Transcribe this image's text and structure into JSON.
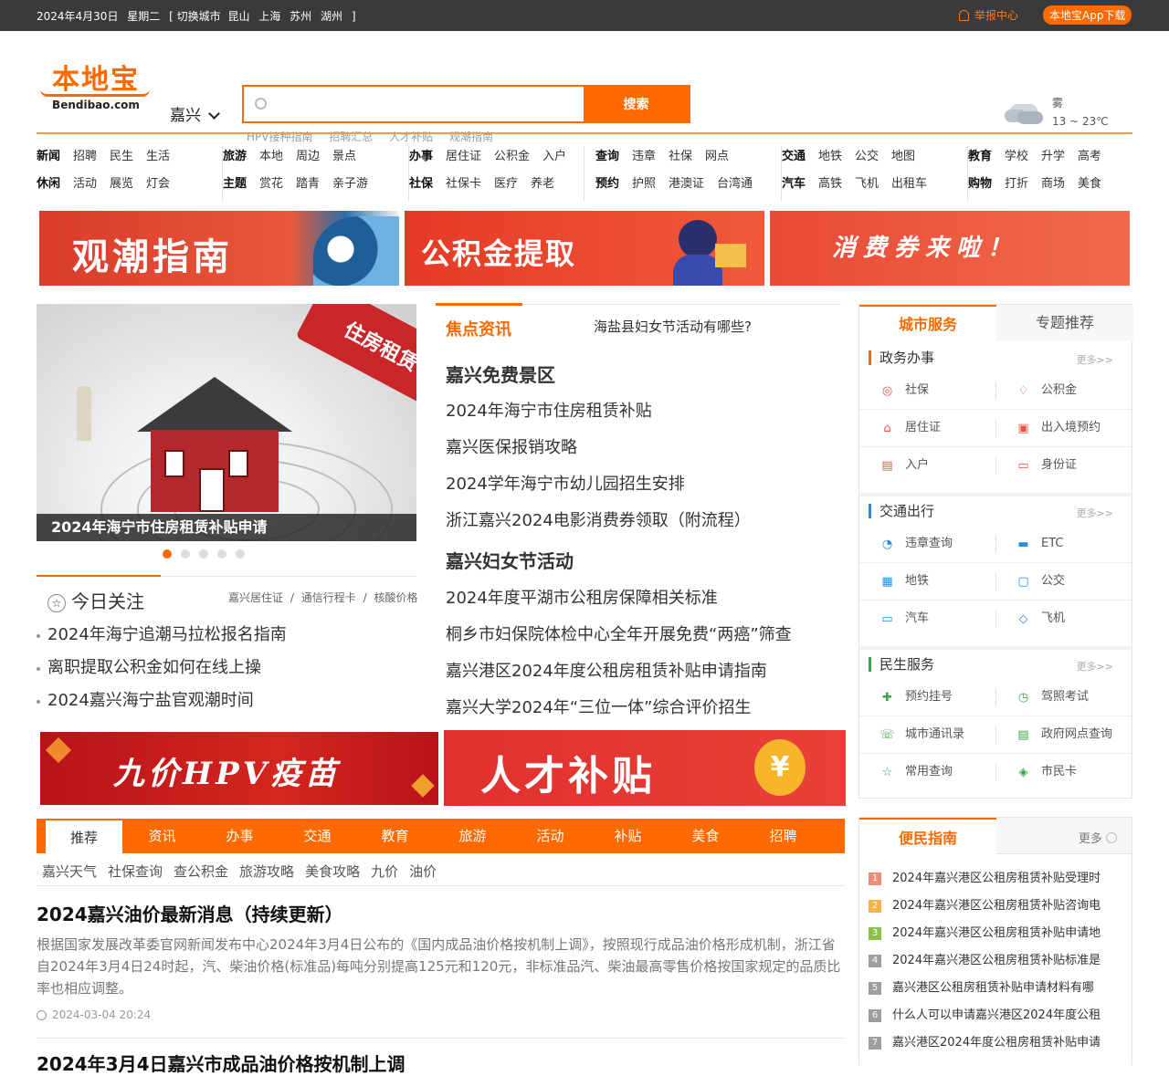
{
  "topbar": {
    "date": "2024年4月30日",
    "weekday": "星期二",
    "switch_city": "[ 切换城市",
    "cities": [
      "昆山",
      "上海",
      "苏州",
      "湖州"
    ],
    "close_bracket": "]",
    "report_center": "举报中心",
    "app_download": "本地宝App下载"
  },
  "header": {
    "logo_cn": "本地宝",
    "logo_en": "Bendibao.com",
    "city": "嘉兴",
    "search_placeholder": "",
    "search_button": "搜索",
    "hot_words": [
      "HPV接种指南",
      "招聘汇总",
      "人才补贴",
      "观潮指南"
    ],
    "weather_desc": "雾",
    "weather_temp": "13 ~ 23℃"
  },
  "nav": [
    {
      "row1": [
        "新闻",
        "招聘",
        "民生",
        "生活"
      ],
      "row2": [
        "休闲",
        "活动",
        "展览",
        "灯会"
      ]
    },
    {
      "row1": [
        "旅游",
        "本地",
        "周边",
        "景点"
      ],
      "row2": [
        "主题",
        "赏花",
        "踏青",
        "亲子游"
      ]
    },
    {
      "row1": [
        "办事",
        "居住证",
        "公积金",
        "入户"
      ],
      "row2": [
        "社保",
        "社保卡",
        "医疗",
        "养老"
      ]
    },
    {
      "row1": [
        "查询",
        "违章",
        "社保",
        "网点"
      ],
      "row2": [
        "预约",
        "护照",
        "港澳证",
        "台湾通"
      ]
    },
    {
      "row1": [
        "交通",
        "地铁",
        "公交",
        "地图"
      ],
      "row2": [
        "汽车",
        "高铁",
        "飞机",
        "出租车"
      ]
    },
    {
      "row1": [
        "教育",
        "学校",
        "升学",
        "高考"
      ],
      "row2": [
        "购物",
        "打折",
        "商场",
        "美食"
      ]
    }
  ],
  "banners_top": [
    "观潮指南",
    "公积金提取",
    "消费券来啦！"
  ],
  "slider": {
    "sign_text": "住房租赁",
    "caption": "2024年海宁市住房租赁补贴申请",
    "active_dot": 1,
    "dot_count": 5
  },
  "today": {
    "title": "今日关注",
    "tags": [
      "嘉兴居住证",
      "/",
      "通信行程卡",
      "/",
      "核酸价格"
    ],
    "items": [
      "2024年海宁追潮马拉松报名指南",
      "离职提取公积金如何在线上操",
      "2024嘉兴海宁盐官观潮时间"
    ]
  },
  "focus": {
    "label": "焦点资讯",
    "question": "海盐县妇女节活动有哪些?",
    "items": [
      {
        "text": "嘉兴免费景区",
        "big": true
      },
      {
        "text": "2024年海宁市住房租赁补贴",
        "big": false
      },
      {
        "text": "嘉兴医保报销攻略",
        "big": false
      },
      {
        "text": "2024学年海宁市幼儿园招生安排",
        "big": false
      },
      {
        "text": "浙江嘉兴2024电影消费券领取（附流程）",
        "big": false
      },
      {
        "text": "嘉兴妇女节活动",
        "big": true
      },
      {
        "text": "2024年度平湖市公租房保障相关标准",
        "big": false
      },
      {
        "text": "桐乡市妇保院体检中心全年开展免费“两癌”筛查",
        "big": false
      },
      {
        "text": "嘉兴港区2024年度公租房租赁补贴申请指南",
        "big": false
      },
      {
        "text": "嘉兴大学2024年“三位一体”综合评价招生",
        "big": false
      }
    ]
  },
  "side": {
    "tab_active": "城市服务",
    "tab_other": "专题推荐",
    "more": "更多>>",
    "sections": [
      {
        "title": "政务办事",
        "cells": [
          "社保",
          "公积金",
          "居住证",
          "出入境预约",
          "入户",
          "身份证"
        ]
      },
      {
        "title": "交通出行",
        "cells": [
          "违章查询",
          "ETC",
          "地铁",
          "公交",
          "汽车",
          "飞机"
        ]
      },
      {
        "title": "民生服务",
        "cells": [
          "预约挂号",
          "驾照考试",
          "城市通讯录",
          "政府网点查询",
          "常用查询",
          "市民卡"
        ]
      }
    ]
  },
  "banners_bottom": [
    "九价HPV疫苗",
    "人才补贴"
  ],
  "tabs": [
    "推荐",
    "资讯",
    "办事",
    "交通",
    "教育",
    "旅游",
    "活动",
    "补贴",
    "美食",
    "招聘"
  ],
  "sublinks": [
    "嘉兴天气",
    "社保查询",
    "查公积金",
    "旅游攻略",
    "美食攻略",
    "九价",
    "油价"
  ],
  "article": {
    "title": "2024嘉兴油价最新消息（持续更新）",
    "summary": "根据国家发展改革委官网新闻发布中心2024年3月4日公布的《国内成品油价格按机制上调》，按照现行成品油价格形成机制，浙江省自2024年3月4日24时起，汽、柴油价格(标准品)每吨分别提高125元和120元，非标准品汽、柴油最高零售价格按国家规定的品质比率也相应调整。",
    "time": "2024-03-04 20:24",
    "next_title": "2024年3月4日嘉兴市成品油价格按机制上调"
  },
  "guide": {
    "title": "便民指南",
    "more": "更多",
    "items": [
      "2024年嘉兴港区公租房租赁补贴受理时",
      "2024年嘉兴港区公租房租赁补贴咨询电",
      "2024年嘉兴港区公租房租赁补贴申请地",
      "2024年嘉兴港区公租房租赁补贴标准是",
      "嘉兴港区公租房租赁补贴申请材料有哪",
      "什么人可以申请嘉兴港区2024年度公租",
      "嘉兴港区2024年度公租房租赁补贴申请"
    ],
    "numbers": [
      "1",
      "2",
      "3",
      "4",
      "5",
      "6",
      "7"
    ]
  },
  "colors": {
    "accent": "#ff6a00",
    "topbar": "#3a3a3a"
  }
}
